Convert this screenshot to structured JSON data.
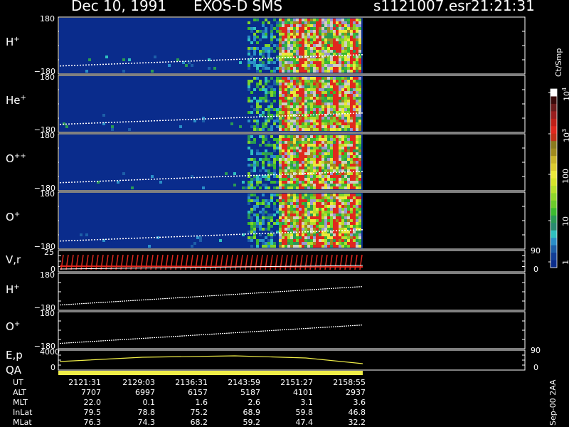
{
  "header": {
    "date": "Dec 10, 1991",
    "instrument": "EXOS-D SMS",
    "file": "s1121007.esr",
    "time": "21:21:31"
  },
  "side_label": "Sep-00 2AA",
  "colors": {
    "background": "#000000",
    "panel_fill": "#0a2c8c",
    "accent_red": "#e0281e",
    "trace": "#ffffff",
    "yellow": "#f0ee48"
  },
  "chart_data": {
    "type": "heatmap",
    "panels": [
      {
        "label": "H",
        "sup": "+",
        "ytop": "180",
        "ybot": "−180",
        "kind": "spectrogram"
      },
      {
        "label": "He",
        "sup": "+",
        "ytop": "180",
        "ybot": "−180",
        "kind": "spectrogram"
      },
      {
        "label": "O",
        "sup": "++",
        "ytop": "180",
        "ybot": "−180",
        "kind": "spectrogram"
      },
      {
        "label": "O",
        "sup": "+",
        "ytop": "180",
        "ybot": "−180",
        "kind": "spectrogram"
      },
      {
        "label": "V,r",
        "sup": "",
        "ytop": "25",
        "ybot": "0",
        "rtop": "90",
        "rbot": "0",
        "kind": "vr"
      },
      {
        "label": "H",
        "sup": "+",
        "ytop": "180",
        "ybot": "−180",
        "kind": "line"
      },
      {
        "label": "O",
        "sup": "+",
        "ytop": "180",
        "ybot": "−180",
        "kind": "line"
      },
      {
        "label": "E,p",
        "sup": "",
        "ytop": "4000",
        "ybot": "0",
        "rtop": "90",
        "rbot": "0",
        "kind": "ep"
      }
    ],
    "qa_label": "QA",
    "colorbar": {
      "unit": "Ct/Smp",
      "ticks": [
        {
          "label": "10",
          "sup": "4"
        },
        {
          "label": "10",
          "sup": "3"
        },
        {
          "label": "100",
          "sup": ""
        },
        {
          "label": "10",
          "sup": ""
        },
        {
          "label": "1",
          "sup": ""
        }
      ]
    },
    "table": {
      "row_labels": [
        "UT",
        "ALT",
        "MLT",
        "InLat",
        "MLat"
      ],
      "columns": [
        [
          "2121:31",
          "7707",
          "22.0",
          "79.5",
          "76.3"
        ],
        [
          "2129:03",
          "6997",
          "0.1",
          "78.8",
          "74.3"
        ],
        [
          "2136:31",
          "6157",
          "1.6",
          "75.2",
          "68.2"
        ],
        [
          "2143:59",
          "5187",
          "2.6",
          "68.9",
          "59.2"
        ],
        [
          "2151:27",
          "4101",
          "3.1",
          "59.8",
          "47.4"
        ],
        [
          "2158:55",
          "2937",
          "3.6",
          "46.8",
          "32.2"
        ]
      ]
    }
  }
}
